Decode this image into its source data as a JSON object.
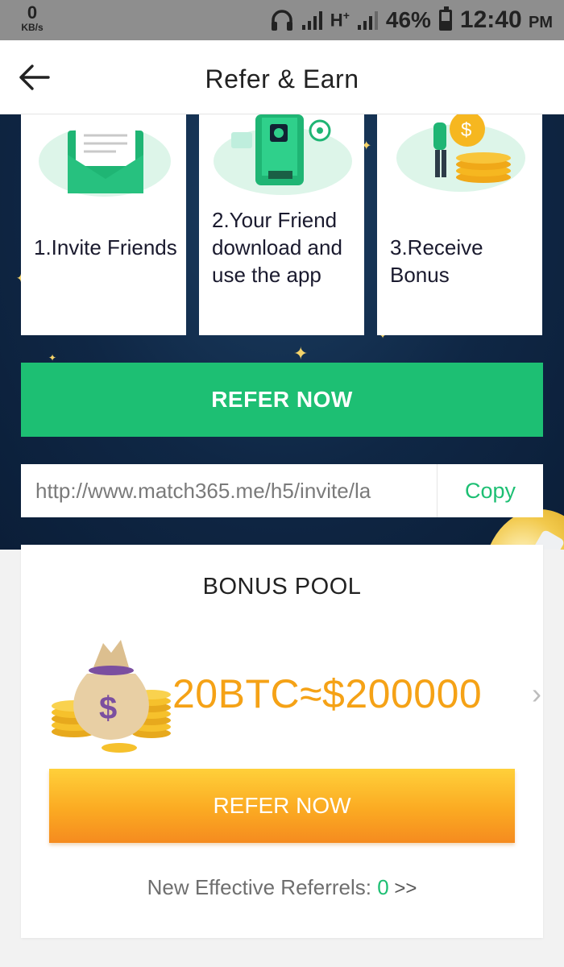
{
  "status_bar": {
    "speed_value": "0",
    "speed_unit": "KB/s",
    "network": "H",
    "network_sup": "+",
    "battery": "46%",
    "time": "12:40",
    "ampm": "PM"
  },
  "header": {
    "title": "Refer & Earn",
    "back_icon": "arrow-left-icon"
  },
  "steps": [
    {
      "text": "1.Invite Friends",
      "icon": "envelope-icon"
    },
    {
      "text": "2.Your Friend download and use the app",
      "icon": "phone-download-icon"
    },
    {
      "text": "3.Receive Bonus",
      "icon": "coins-icon"
    }
  ],
  "refer_button": "REFER NOW",
  "invite": {
    "link": "http://www.match365.me/h5/invite/la",
    "copy_label": "Copy"
  },
  "bonus_pool": {
    "title": "BONUS POOL",
    "amount": "20BTC≈$200000",
    "chevron": "›",
    "refer_label": "REFER NOW",
    "referrals_label": "New Effective Referrels: ",
    "referrals_count": "0",
    "referrals_more": " >>"
  },
  "colors": {
    "accent_green": "#1dbf73",
    "amount_orange": "#f5a216",
    "hero_navy": "#0f2745"
  }
}
